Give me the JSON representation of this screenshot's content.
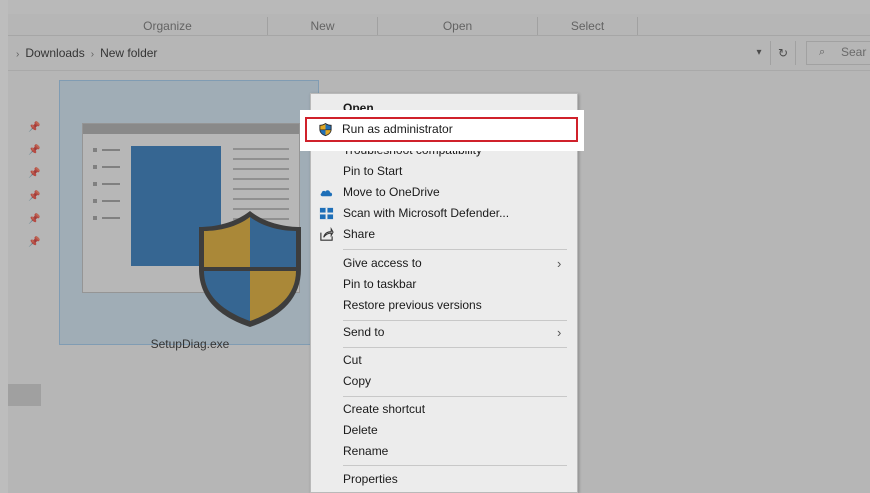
{
  "ribbon": {
    "groups": [
      {
        "label": "Organize"
      },
      {
        "label": "New"
      },
      {
        "label": "Open"
      },
      {
        "label": "Select"
      }
    ]
  },
  "address": {
    "breadcrumb": [
      "Downloads",
      "New folder"
    ],
    "search_placeholder": "Sear"
  },
  "file": {
    "name": "SetupDiag.exe"
  },
  "context_menu": {
    "items": [
      {
        "label": "Open",
        "bold": true
      },
      {
        "label": "Run as administrator",
        "icon": "uac-shield-icon",
        "highlighted": true
      },
      {
        "label": "Troubleshoot compatibility"
      },
      {
        "label": "Pin to Start"
      },
      {
        "label": "Move to OneDrive",
        "icon": "onedrive-cloud-icon"
      },
      {
        "label": "Scan with Microsoft Defender...",
        "icon": "defender-icon"
      },
      {
        "label": "Share",
        "icon": "share-icon"
      },
      {
        "label": "Give access to",
        "submenu": true
      },
      {
        "label": "Pin to taskbar"
      },
      {
        "label": "Restore previous versions"
      },
      {
        "label": "Send to",
        "submenu": true
      },
      {
        "label": "Cut"
      },
      {
        "label": "Copy"
      },
      {
        "label": "Create shortcut"
      },
      {
        "label": "Delete"
      },
      {
        "label": "Rename"
      },
      {
        "label": "Properties"
      }
    ]
  },
  "colors": {
    "highlight_border": "#d0212b",
    "selection_fill": "#cfe4f3",
    "shield_blue": "#1e6fb8",
    "shield_gold": "#e0a722"
  }
}
